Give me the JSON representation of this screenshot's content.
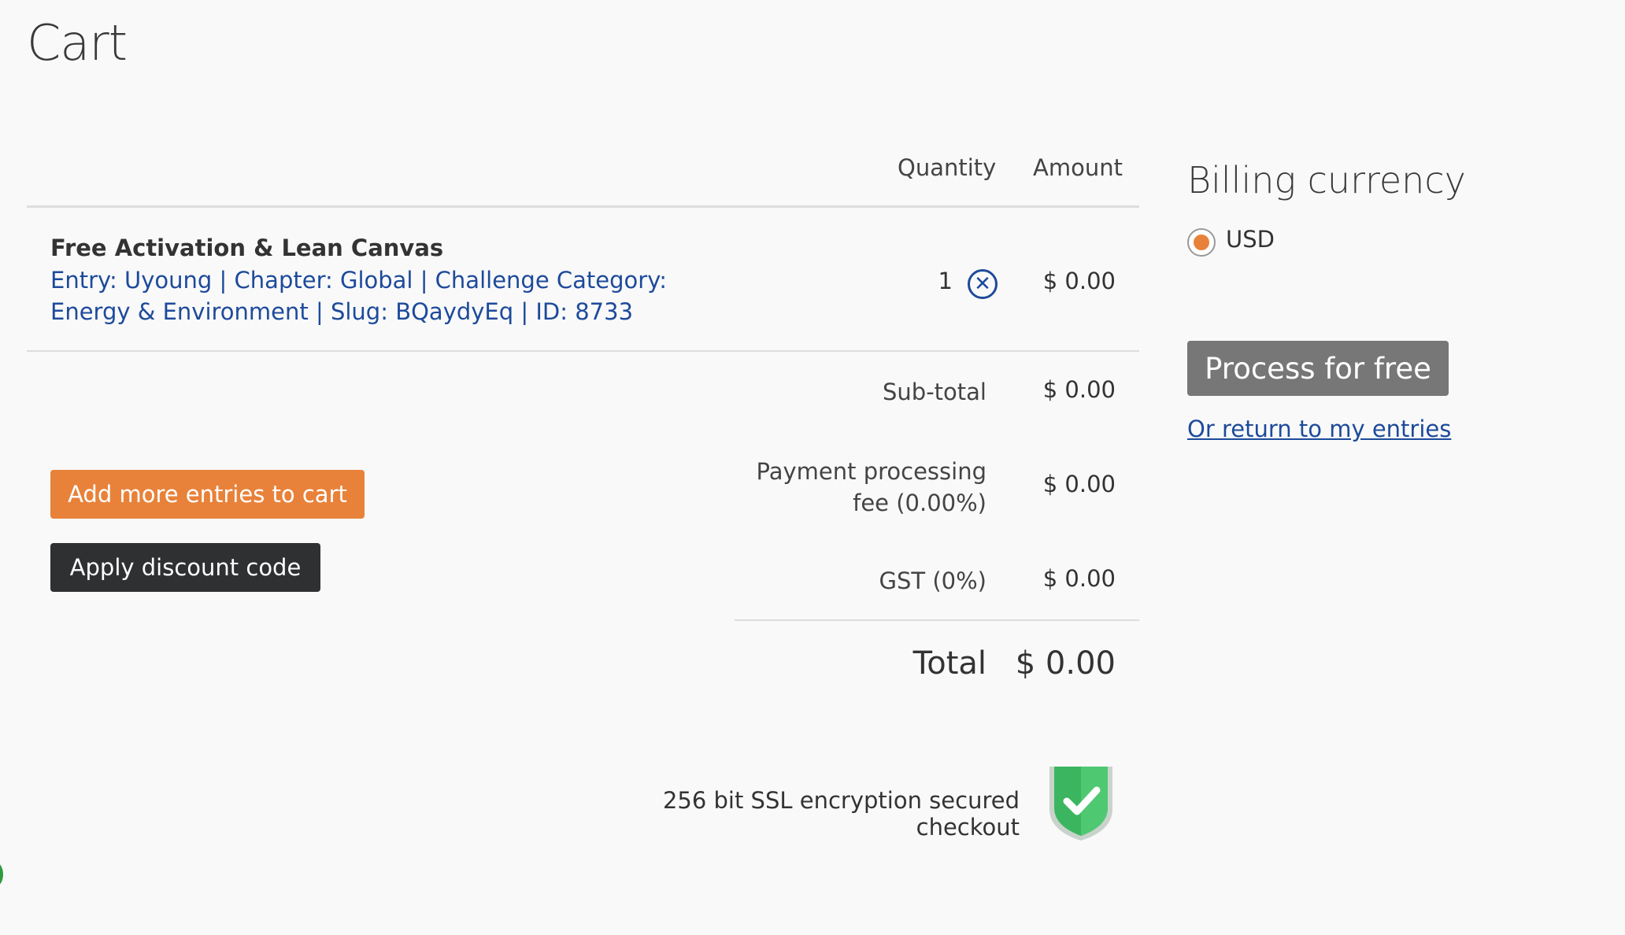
{
  "page": {
    "title": "Cart"
  },
  "table": {
    "headers": {
      "quantity": "Quantity",
      "amount": "Amount"
    },
    "items": [
      {
        "title": "Free Activation & Lean Canvas",
        "description": "Entry: Uyoung | Chapter: Global | Challenge Category: Energy & Environment | Slug: BQaydyEq | ID: 8733",
        "quantity": "1",
        "amount": "$ 0.00",
        "remove_icon": "circle-x-icon"
      }
    ]
  },
  "summary": {
    "subtotal_label": "Sub-total",
    "subtotal_value": "$ 0.00",
    "fee_label": "Payment processing fee (0.00%)",
    "fee_value": "$ 0.00",
    "gst_label": "GST (0%)",
    "gst_value": "$ 0.00",
    "total_label": "Total",
    "total_value": "$ 0.00"
  },
  "actions": {
    "add_more_label": "Add more entries to cart",
    "discount_label": "Apply discount code"
  },
  "security": {
    "text": "256 bit SSL encryption secured checkout",
    "icon": "shield-check-icon"
  },
  "billing": {
    "title": "Billing currency",
    "currency_option": "USD",
    "currency_selected": true,
    "process_label": "Process for free",
    "return_label": "Or return to my entries"
  },
  "colors": {
    "accent_orange": "#e8823a",
    "link_blue": "#1d4a9b",
    "dark_button": "#2f3032",
    "grey_button": "#777777",
    "shield_green": "#3cb560"
  }
}
